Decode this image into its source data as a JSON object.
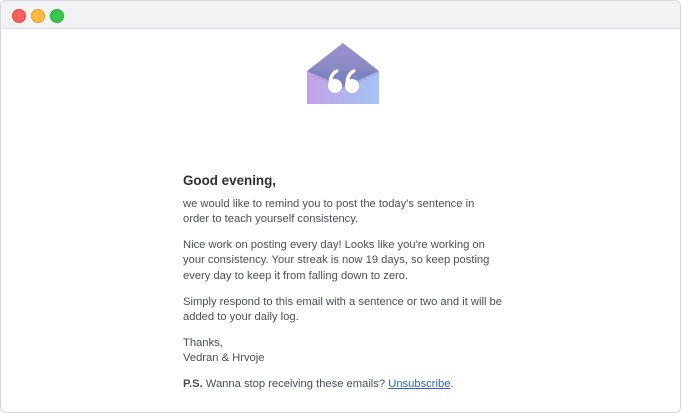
{
  "window": {
    "controls": [
      "close",
      "minimize",
      "maximize"
    ]
  },
  "logo": {
    "icon": "envelope-quote-icon",
    "colors": {
      "flap": "#8f8fc9",
      "body_left": "#b89be0",
      "body_right": "#9fc2f2"
    }
  },
  "email": {
    "greeting": "Good evening,",
    "paragraph_1": "we would like to remind you to post the today's sentence in order to teach yourself consistency.",
    "paragraph_2": "Nice work on posting every day! Looks like you're working on your consistency. Your streak is now 19 days, so keep posting every day to keep it from falling down to zero.",
    "paragraph_3": "Simply respond to this email with a sentence or two and it will be added to your daily log.",
    "signoff": "Thanks,",
    "signature": "Vedran & Hrvoje",
    "ps": {
      "label": "P.S.",
      "text": " Wanna stop receiving these emails? ",
      "link_label": "Unsubscribe",
      "suffix": "."
    }
  }
}
